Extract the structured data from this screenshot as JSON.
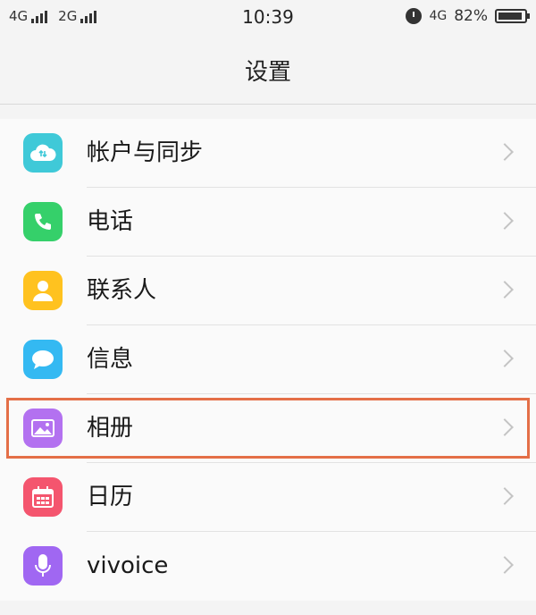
{
  "status_bar": {
    "sim1_label": "4G",
    "sim2_label": "2G",
    "time": "10:39",
    "network_label": "4G",
    "battery_percent": "82%",
    "battery_level": 0.82,
    "icons": [
      "signal-icon",
      "alarm-icon",
      "battery-icon"
    ]
  },
  "nav": {
    "title": "设置"
  },
  "settings": {
    "items": [
      {
        "label": "帐户与同步",
        "icon": "cloud-sync-icon",
        "color": "#3fc9d8"
      },
      {
        "label": "电话",
        "icon": "phone-icon",
        "color": "#35d06a"
      },
      {
        "label": "联系人",
        "icon": "contact-icon",
        "color": "#ffc21f"
      },
      {
        "label": "信息",
        "icon": "message-icon",
        "color": "#34b9f2"
      },
      {
        "label": "相册",
        "icon": "gallery-icon",
        "color": "#b371f0",
        "highlighted": true
      },
      {
        "label": "日历",
        "icon": "calendar-icon",
        "color": "#f4556e"
      },
      {
        "label": "vivoice",
        "icon": "microphone-icon",
        "color": "#a067f2"
      }
    ]
  },
  "colors": {
    "highlight_border": "#e46f47",
    "chevron": "#c4c4c4"
  }
}
